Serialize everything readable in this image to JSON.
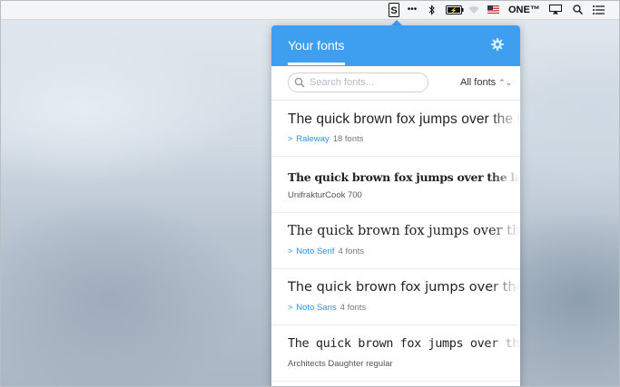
{
  "menubar": {
    "items": [
      "S",
      "•••",
      "ᛒ",
      "⚡",
      "",
      "",
      "ONE™",
      "",
      "",
      ""
    ],
    "one_label": "ONE™"
  },
  "popover": {
    "title": "Your fonts",
    "search_placeholder": "Search fonts...",
    "filter_label": "All fonts",
    "fonts": [
      {
        "sample": "The quick brown fox jumps over the lazy dog",
        "family": "Raleway",
        "count": "18 fonts",
        "expandable": true
      },
      {
        "sample": "The quick brown fox jumps over the lazy dog",
        "family": "UnifrakturCook 700",
        "count": "",
        "expandable": false
      },
      {
        "sample": "The quick brown fox jumps over the lazy dog",
        "family": "Noto Serif",
        "count": "4 fonts",
        "expandable": true
      },
      {
        "sample": "The quick brown fox jumps over the lazy dog",
        "family": "Noto Sans",
        "count": "4 fonts",
        "expandable": true
      },
      {
        "sample": "The quick brown fox jumps over the lazy dog",
        "family": "Architects Daughter regular",
        "count": "",
        "expandable": false
      }
    ]
  },
  "colors": {
    "accent": "#3e9ff0",
    "link": "#2f8fe8"
  }
}
